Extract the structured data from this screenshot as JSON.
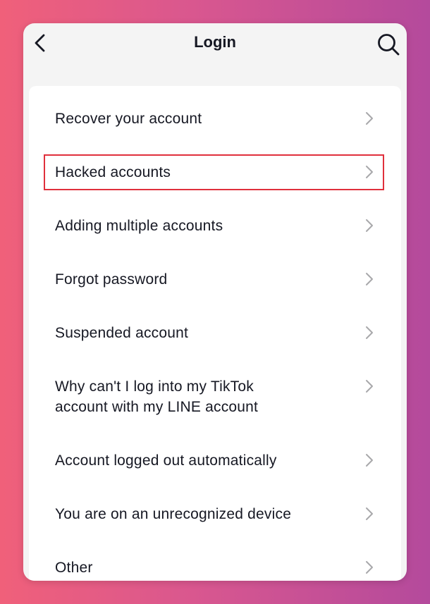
{
  "header": {
    "title": "Login",
    "back_icon": "chevron-left-icon",
    "search_icon": "search-icon"
  },
  "items": [
    {
      "label": "Recover your account"
    },
    {
      "label": "Hacked accounts"
    },
    {
      "label": "Adding multiple accounts"
    },
    {
      "label": "Forgot password"
    },
    {
      "label": "Suspended account"
    },
    {
      "label": "Why can't I log into my TikTok account with my LINE account"
    },
    {
      "label": "Account logged out automatically"
    },
    {
      "label": "You are on an unrecognized device"
    },
    {
      "label": "Other"
    }
  ],
  "colors": {
    "highlight_border": "#e0303c",
    "text": "#161823",
    "chevron": "#a8a8ab"
  }
}
